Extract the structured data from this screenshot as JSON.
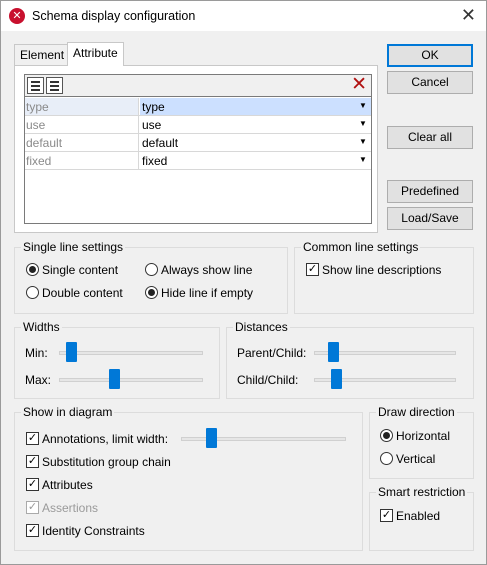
{
  "window": {
    "title": "Schema display configuration"
  },
  "tabs": [
    {
      "label": "Element"
    },
    {
      "label": "Attribute"
    }
  ],
  "attribute_grid": {
    "rows": [
      {
        "name": "type",
        "value": "type"
      },
      {
        "name": "use",
        "value": "use"
      },
      {
        "name": "default",
        "value": "default"
      },
      {
        "name": "fixed",
        "value": "fixed"
      }
    ]
  },
  "buttons": {
    "ok": "OK",
    "cancel": "Cancel",
    "clear_all": "Clear all",
    "predefined": "Predefined",
    "load_save": "Load/Save"
  },
  "single_line": {
    "title": "Single line settings",
    "single_content": "Single content",
    "double_content": "Double content",
    "always_show_line": "Always show line",
    "hide_line_if_empty": "Hide line if empty",
    "content_mode": "single",
    "line_mode": "hide"
  },
  "common_line": {
    "title": "Common line settings",
    "show_line_descriptions": "Show line descriptions",
    "show_line_descriptions_checked": true
  },
  "widths": {
    "title": "Widths",
    "min_label": "Min:",
    "max_label": "Max:",
    "min_level": 0.05,
    "max_level": 0.35
  },
  "distances": {
    "title": "Distances",
    "parent_child_label": "Parent/Child:",
    "child_child_label": "Child/Child:",
    "parent_child_level": 0.1,
    "child_child_level": 0.12
  },
  "show_in_diagram": {
    "title": "Show in diagram",
    "items": [
      {
        "label": "Annotations, limit width:",
        "checked": true,
        "enabled": true
      },
      {
        "label": "Substitution group chain",
        "checked": true,
        "enabled": true
      },
      {
        "label": "Attributes",
        "checked": true,
        "enabled": true
      },
      {
        "label": "Assertions",
        "checked": true,
        "enabled": false
      },
      {
        "label": "Identity Constraints",
        "checked": true,
        "enabled": true
      }
    ],
    "annotation_width_level": 0.15
  },
  "draw_direction": {
    "title": "Draw direction",
    "horizontal": "Horizontal",
    "vertical": "Vertical",
    "selected": "horizontal"
  },
  "smart_restriction": {
    "title": "Smart restriction",
    "enabled_label": "Enabled",
    "enabled_checked": true
  },
  "colors": {
    "accent": "#0078d7",
    "delete": "#b01010",
    "selection": "#cce0ff"
  }
}
